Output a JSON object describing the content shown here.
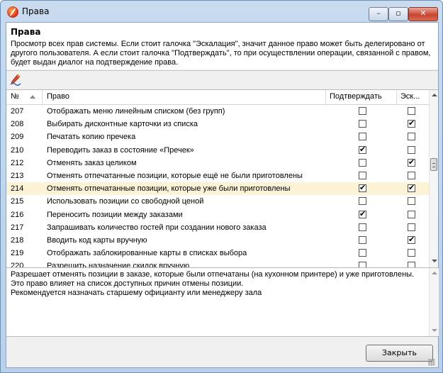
{
  "window": {
    "title": "Права",
    "min_glyph": "–",
    "max_glyph": "▫",
    "close_glyph": "✕"
  },
  "header": {
    "title": "Права",
    "description": "Просмотр всех прав системы. Если стоит галочка \"Эскалация\", значит данное право может быть делегировано от другого пользователя. А если стоит галочка \"Подтверждать\", то при осуществлении операции, связанной с правом, будет выдан диалог на подтверждение права."
  },
  "toolbar": {
    "edit_icon": "edit-pencil-icon"
  },
  "grid": {
    "columns": {
      "num": "№",
      "name": "Право",
      "confirm": "Подтверждать",
      "escalate": "Эск..."
    },
    "rows": [
      {
        "num": "207",
        "name": "Отображать меню линейным списком (без групп)",
        "confirm": false,
        "escalate": false
      },
      {
        "num": "208",
        "name": "Выбирать дисконтные карточки из списка",
        "confirm": false,
        "escalate": true
      },
      {
        "num": "209",
        "name": "Печатать копию пречека",
        "confirm": false,
        "escalate": false
      },
      {
        "num": "210",
        "name": "Переводить заказ в состояние «Пречек»",
        "confirm": true,
        "escalate": false
      },
      {
        "num": "212",
        "name": "Отменять заказ целиком",
        "confirm": false,
        "escalate": true
      },
      {
        "num": "213",
        "name": "Отменять отпечатанные позиции, которые ещё не были приготовлены",
        "confirm": false,
        "escalate": false
      },
      {
        "num": "214",
        "name": "Отменять отпечатанные позиции, которые уже были приготовлены",
        "confirm": true,
        "escalate": true,
        "selected": true
      },
      {
        "num": "215",
        "name": "Использовать позиции со свободной ценой",
        "confirm": false,
        "escalate": false
      },
      {
        "num": "216",
        "name": "Переносить позиции между заказами",
        "confirm": true,
        "escalate": false
      },
      {
        "num": "217",
        "name": "Запрашивать количество гостей при создании нового заказа",
        "confirm": false,
        "escalate": false
      },
      {
        "num": "218",
        "name": "Вводить код карты вручную",
        "confirm": false,
        "escalate": true
      },
      {
        "num": "219",
        "name": "Отображать заблокированные карты в списках выбора",
        "confirm": false,
        "escalate": false
      },
      {
        "num": "220",
        "name": "Разрешить назначение скидок вручную",
        "confirm": false,
        "escalate": false
      }
    ]
  },
  "details": {
    "lines": [
      "Разрешает отменять позиции в заказе, которые были отпечатаны (на кухонном принтере) и уже приготовлены.",
      "Это право влияет на список доступных причин отмены позиции.",
      "Рекомендуется назначать старшему официанту или менеджеру зала"
    ]
  },
  "footer": {
    "close_label": "Закрыть"
  }
}
